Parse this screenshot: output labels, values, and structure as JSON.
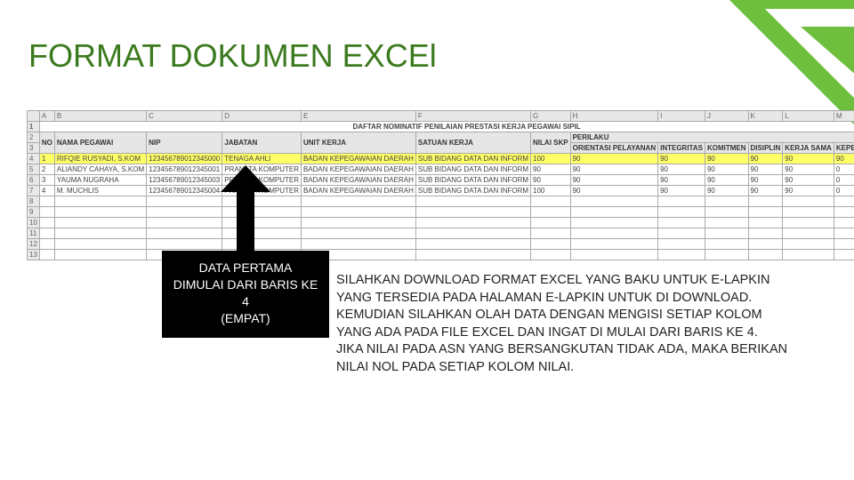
{
  "title": "FORMAT DOKUMEN EXCEl",
  "sheet": {
    "cols": [
      "",
      "A",
      "B",
      "C",
      "D",
      "E",
      "F",
      "G",
      "H",
      "I",
      "J",
      "K",
      "L",
      "M"
    ],
    "doc_title": "DAFTAR NOMINATIF PENILAIAN PRESTASI KERJA PEGAWAI SIPIL",
    "headers": {
      "no": "NO",
      "nama": "NAMA PEGAWAI",
      "nip": "NIP",
      "jabatan": "JABATAN",
      "unit": "UNIT KERJA",
      "satuan": "SATUAN KERJA",
      "nilai_skp": "NILAI SKP",
      "perilaku": "PERILAKU",
      "p1": "ORIENTASI PELAYANAN",
      "p2": "INTEGRITAS",
      "p3": "KOMITMEN",
      "p4": "DISIPLIN",
      "p5": "KERJA SAMA",
      "p6": "KEPEMIMPINAN"
    },
    "rows": [
      {
        "no": "1",
        "nama": "RIFQIE RUSYADI, S.KOM",
        "nip": "123456789012345000",
        "jabatan": "TENAGA AHLI",
        "unit": "BADAN KEPEGAWAIAN DAERAH",
        "satuan": "SUB BIDANG DATA DAN INFORM",
        "skp": "100",
        "v": [
          "90",
          "90",
          "90",
          "90",
          "90",
          "90"
        ],
        "hl": true
      },
      {
        "no": "2",
        "nama": "ALIANDY CAHAYA, S.KOM",
        "nip": "123456789012345001",
        "jabatan": "PRANATA KOMPUTER",
        "unit": "BADAN KEPEGAWAIAN DAERAH",
        "satuan": "SUB BIDANG DATA DAN INFORM",
        "skp": "90",
        "v": [
          "90",
          "90",
          "90",
          "90",
          "90",
          "0"
        ]
      },
      {
        "no": "3",
        "nama": "YAUMA NUGRAHA",
        "nip": "123456789012345003",
        "jabatan": "PRANATA KOMPUTER",
        "unit": "BADAN KEPEGAWAIAN DAERAH",
        "satuan": "SUB BIDANG DATA DAN INFORM",
        "skp": "90",
        "v": [
          "90",
          "90",
          "90",
          "90",
          "90",
          "0"
        ]
      },
      {
        "no": "4",
        "nama": "M. MUCHLIS",
        "nip": "123456789012345004",
        "jabatan": "PRANATA KOMPUTER",
        "unit": "BADAN KEPEGAWAIAN DAERAH",
        "satuan": "SUB BIDANG DATA DAN INFORM",
        "skp": "100",
        "v": [
          "90",
          "90",
          "90",
          "90",
          "90",
          "0"
        ]
      }
    ],
    "empty_rows": [
      "8",
      "9",
      "10",
      "11",
      "12",
      "13"
    ]
  },
  "callout": {
    "l1": "DATA PERTAMA",
    "l2": "DIMULAI DARI BARIS KE",
    "l3": "4",
    "l4": "(EMPAT)"
  },
  "body": {
    "l1": "SILAHKAN DOWNLOAD FORMAT EXCEL YANG BAKU UNTUK E-LAPKIN",
    "l2": "YANG TERSEDIA PADA HALAMAN E-LAPKIN UNTUK DI DOWNLOAD.",
    "l3": "KEMUDIAN SILAHKAN OLAH DATA  DENGAN MENGISI SETIAP KOLOM",
    "l4": "YANG ADA PADA FILE EXCEL DAN INGAT DI MULAI DARI BARIS KE 4.",
    "l5": "JIKA NILAI PADA ASN YANG BERSANGKUTAN TIDAK ADA, MAKA BERIKAN",
    "l6": "NILAI NOL PADA SETIAP KOLOM NILAI."
  },
  "colors": {
    "accent": "#6fbf3f"
  }
}
